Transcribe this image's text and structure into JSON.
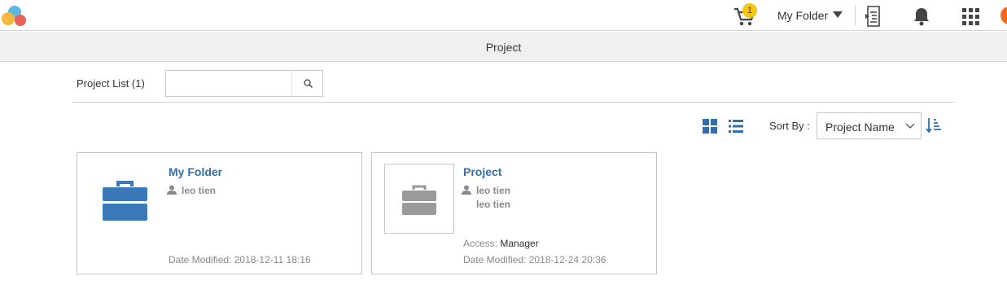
{
  "topbar": {
    "cart_count": "1",
    "folder_menu_label": "My Folder"
  },
  "subheader": {
    "title": "Project"
  },
  "toolbar": {
    "list_title": "Project List (1)",
    "search": {
      "value": "",
      "placeholder": ""
    },
    "sort_label": "Sort By :",
    "sort_value": "Project Name"
  },
  "cards": [
    {
      "name": "My Folder",
      "owners": [
        "leo tien"
      ],
      "date_label": "Date Modified:",
      "date_value": "2018-12-11 18:16"
    },
    {
      "name": "Project",
      "owners": [
        "leo tien",
        "leo tien"
      ],
      "access_label": "Access:",
      "access_value": "Manager",
      "date_label": "Date Modified:",
      "date_value": "2018-12-24 20:36"
    }
  ],
  "colors": {
    "accent_blue": "#2f6fae",
    "folder_icon_blue": "#3a78b8",
    "badge_yellow": "#f5c518",
    "avatar_orange": "#f26b1d"
  },
  "icons": {
    "logo": "app-logo-icon",
    "cart": "cart-icon",
    "caret": "caret-down-icon",
    "import": "document-import-icon",
    "bell": "bell-icon",
    "apps": "apps-grid-icon",
    "search": "search-icon",
    "grid_view": "grid-view-icon",
    "list_view": "list-view-icon",
    "sort_order": "sort-order-icon",
    "briefcase": "briefcase-icon",
    "person": "person-icon"
  }
}
